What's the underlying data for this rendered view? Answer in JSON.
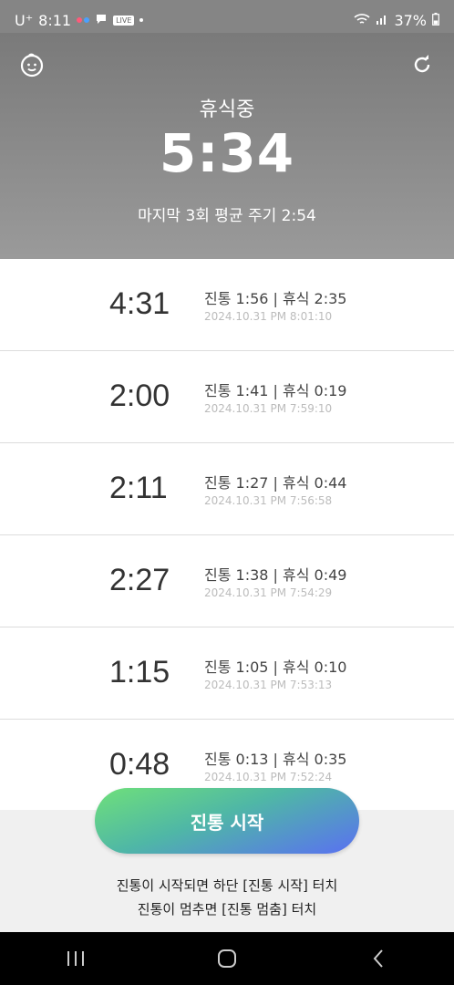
{
  "status_bar": {
    "carrier": "U⁺",
    "time": "8:11",
    "live_badge": "LIVE",
    "battery": "37%"
  },
  "header": {
    "state_label": "휴식중",
    "timer": "5:34",
    "avg_text": "마지막 3회 평균 주기 2:54",
    "left_icon": "baby-face-icon",
    "right_icon": "refresh-icon"
  },
  "records": [
    {
      "interval": "4:31",
      "detail": "진통 1:56 | 휴식 2:35",
      "timestamp": "2024.10.31 PM 8:01:10"
    },
    {
      "interval": "2:00",
      "detail": "진통 1:41 | 휴식 0:19",
      "timestamp": "2024.10.31 PM 7:59:10"
    },
    {
      "interval": "2:11",
      "detail": "진통 1:27 | 휴식 0:44",
      "timestamp": "2024.10.31 PM 7:56:58"
    },
    {
      "interval": "2:27",
      "detail": "진통 1:38 | 휴식 0:49",
      "timestamp": "2024.10.31 PM 7:54:29"
    },
    {
      "interval": "1:15",
      "detail": "진통 1:05 | 휴식 0:10",
      "timestamp": "2024.10.31 PM 7:53:13"
    },
    {
      "interval": "0:48",
      "detail": "진통 0:13 | 휴식 0:35",
      "timestamp": "2024.10.31 PM 7:52:24"
    }
  ],
  "bottom": {
    "start_button": "진통 시작",
    "hint_line1": "진통이 시작되면 하단 [진통 시작] 터치",
    "hint_line2": "진통이 멈추면 [진통 멈춤] 터치"
  },
  "colors": {
    "header_bg": "#8a8a8a",
    "button_gradient_start": "#6fe07a",
    "button_gradient_end": "#5a70f2"
  }
}
